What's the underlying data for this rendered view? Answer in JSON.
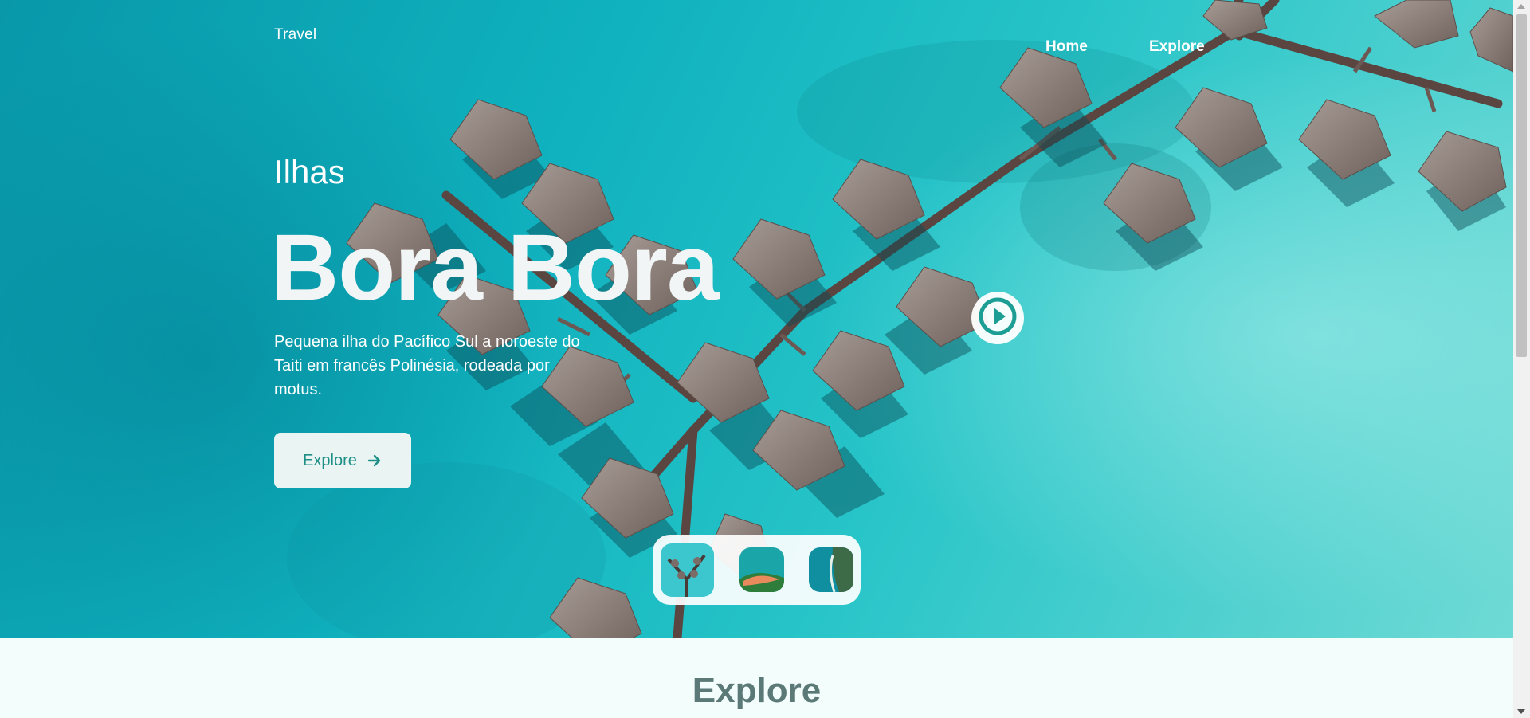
{
  "nav": {
    "logo": "Travel",
    "links": [
      {
        "label": "Home"
      },
      {
        "label": "Explore"
      }
    ]
  },
  "hero": {
    "subtitle": "Ilhas",
    "title": "Bora Bora",
    "description": "Pequena ilha do Pacífico Sul a noroeste do Taiti em francês Polinésia, rodeada por motus.",
    "button_label": "Explore",
    "button_icon": "arrow-right-icon",
    "play_icon": "play-circle-icon"
  },
  "thumbnails": [
    {
      "name": "bungalows-thumbnail"
    },
    {
      "name": "beach-thumbnail"
    },
    {
      "name": "cliffs-thumbnail"
    }
  ],
  "section": {
    "title": "Explore"
  },
  "colors": {
    "accent": "#1d9e94",
    "button_bg": "#eaf4f3",
    "section_title": "#5b7a77",
    "page_bg": "#f3fdfc"
  }
}
